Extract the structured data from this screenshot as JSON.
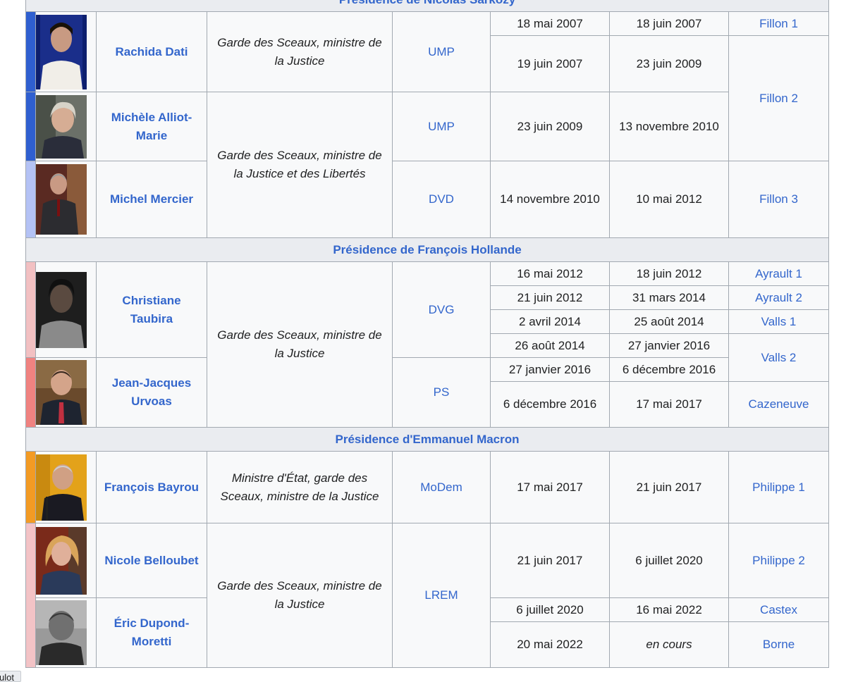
{
  "colors": {
    "ump": "#2f5fd0",
    "dvd": "#b4c2f5",
    "dvg": "#f2c0c2",
    "ps": "#f08280",
    "modem": "#f39b24",
    "lrem": "#f3c3c6",
    "link": "#3366cc"
  },
  "sections": {
    "sarkozy": "Présidence de Nicolas Sarkozy",
    "hollande": "Présidence de François Hollande",
    "macron": "Présidence d'Emmanuel Macron"
  },
  "ministers": {
    "dati": {
      "name": "Rachida Dati",
      "photo_icon": "portrait-photo"
    },
    "alliot": {
      "name": "Michèle Alliot-Marie",
      "photo_icon": "portrait-photo"
    },
    "mercier": {
      "name": "Michel Mercier",
      "photo_icon": "portrait-photo"
    },
    "taubira": {
      "name": "Christiane Taubira",
      "photo_icon": "portrait-photo"
    },
    "urvoas": {
      "name": "Jean-Jacques Urvoas",
      "photo_icon": "portrait-photo"
    },
    "bayrou": {
      "name": "François Bayrou",
      "photo_icon": "portrait-photo"
    },
    "belloubet": {
      "name": "Nicole Belloubet",
      "photo_icon": "portrait-photo"
    },
    "dupond": {
      "name": "Éric Dupond-Moretti",
      "photo_icon": "portrait-photo"
    }
  },
  "functions": {
    "justice": "Garde des Sceaux, ministre de la Justice",
    "libertes": "Garde des Sceaux, ministre de la Justice et des Libertés",
    "etat": "Ministre d'État, garde des Sceaux, ministre de la Justice"
  },
  "parties": {
    "ump": "UMP",
    "dvd": "DVD",
    "dvg": "DVG",
    "ps": "PS",
    "modem": "MoDem",
    "lrem": "LREM"
  },
  "terms": [
    {
      "start": "18 mai 2007",
      "end": "18 juin 2007",
      "gov": "Fillon 1"
    },
    {
      "start": "19 juin 2007",
      "end": "23 juin 2009",
      "gov": "Fillon 2"
    },
    {
      "start": "23 juin 2009",
      "end": "13 novembre 2010"
    },
    {
      "start": "14 novembre 2010",
      "end": "10 mai 2012",
      "gov": "Fillon 3"
    },
    {
      "start": "16 mai 2012",
      "end": "18 juin 2012",
      "gov": "Ayrault 1"
    },
    {
      "start": "21 juin 2012",
      "end": "31 mars 2014",
      "gov": "Ayrault 2"
    },
    {
      "start": "2 avril 2014",
      "end": "25 août 2014",
      "gov": "Valls 1"
    },
    {
      "start": "26 août 2014",
      "end": "27 janvier 2016",
      "gov": "Valls 2"
    },
    {
      "start": "27 janvier 2016",
      "end": "6 décembre 2016"
    },
    {
      "start": "6 décembre 2016",
      "end": "17 mai 2017",
      "gov": "Cazeneuve"
    },
    {
      "start": "17 mai 2017",
      "end": "21 juin 2017",
      "gov": "Philippe 1"
    },
    {
      "start": "21 juin 2017",
      "end": "6 juillet 2020",
      "gov": "Philippe 2"
    },
    {
      "start": "6 juillet 2020",
      "end": "16 mai 2022",
      "gov": "Castex"
    },
    {
      "start": "20 mai 2022",
      "end": "en cours",
      "gov": "Borne"
    }
  ],
  "footer": {
    "label": "ulot"
  }
}
